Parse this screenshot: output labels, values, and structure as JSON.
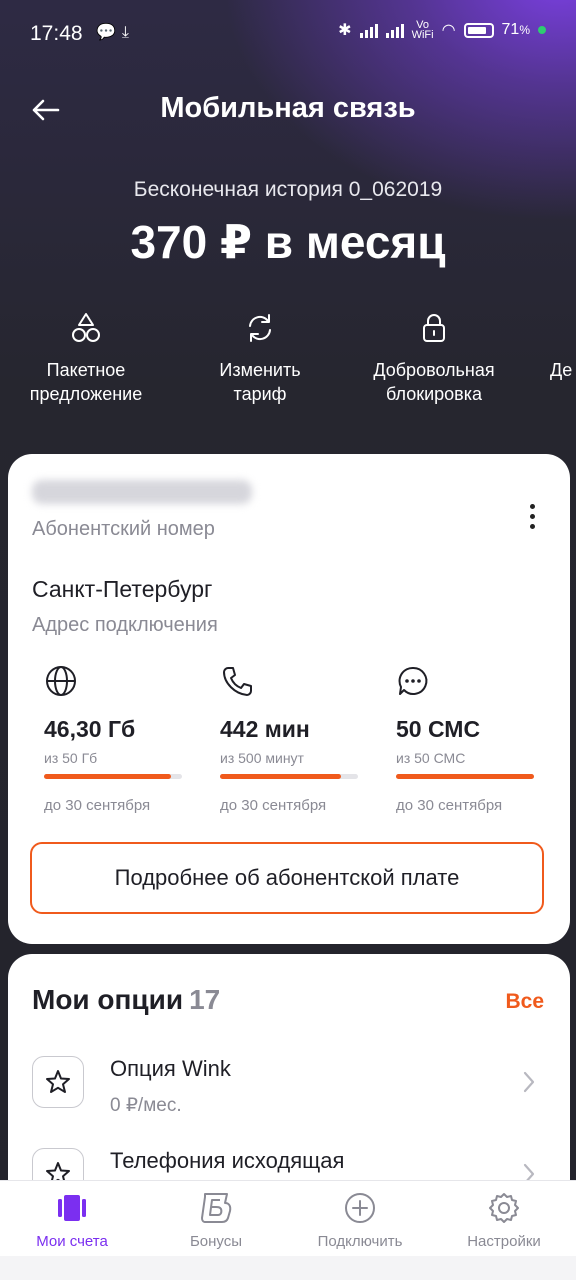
{
  "status": {
    "time": "17:48",
    "battery": "71",
    "battery_unit": "%"
  },
  "header": {
    "title": "Мобильная связь"
  },
  "tariff": {
    "name": "Бесконечная история 0_062019",
    "price": "370 ₽ в месяц"
  },
  "actions": [
    {
      "label_line1": "Пакетное",
      "label_line2": "предложение",
      "icon": "shapes-icon"
    },
    {
      "label_line1": "Изменить",
      "label_line2": "тариф",
      "icon": "refresh-icon"
    },
    {
      "label_line1": "Добровольная",
      "label_line2": "блокировка",
      "icon": "lock-icon"
    },
    {
      "label_line1": "Де",
      "label_line2": "",
      "icon": ""
    }
  ],
  "account": {
    "phone_label": "Абонентский номер",
    "city": "Санкт-Петербург",
    "address_label": "Адрес подключения"
  },
  "stats": [
    {
      "value": "46,30 Гб",
      "total": "из 50 Гб",
      "until": "до 30 сентября",
      "fill": 0.92,
      "icon": "globe-icon"
    },
    {
      "value": "442 мин",
      "total": "из 500 минут",
      "until": "до 30 сентября",
      "fill": 0.88,
      "icon": "phone-icon"
    },
    {
      "value": "50 СМС",
      "total": "из 50 СМС",
      "until": "до 30 сентября",
      "fill": 1.0,
      "icon": "chat-icon"
    }
  ],
  "details_button": "Подробнее об абонентской плате",
  "options": {
    "title": "Мои опции",
    "count": "17",
    "all_label": "Все",
    "items": [
      {
        "name": "Опция Wink",
        "price": "0 ₽/мес."
      },
      {
        "name": "Телефония исходящая",
        "price": ""
      }
    ]
  },
  "nav": [
    {
      "label": "Мои счета",
      "icon": "accounts-icon",
      "active": true
    },
    {
      "label": "Бонусы",
      "icon": "bonus-icon",
      "active": false
    },
    {
      "label": "Подключить",
      "icon": "plus-icon",
      "active": false
    },
    {
      "label": "Настройки",
      "icon": "gear-icon",
      "active": false
    }
  ],
  "colors": {
    "accent": "#f05a1c",
    "brand": "#7b2ff0"
  }
}
